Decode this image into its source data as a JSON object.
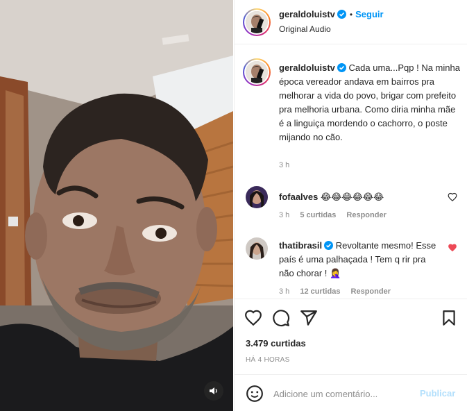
{
  "post": {
    "username": "geraldoluistv",
    "follow_label": "Seguir",
    "separator": "•",
    "audio": "Original Audio",
    "caption": "Cada uma...Pqp ! Na minha época vereador andava em bairros pra melhorar a vida do povo, brigar com prefeito pra melhoria urbana. Como diria minha mãe é a linguiça mordendo o cachorro, o poste mijando no cão.",
    "caption_time": "3 h",
    "likes": "3.479 curtidas",
    "posted_ago": "HÁ 4 HORAS"
  },
  "comments": [
    {
      "username": "fofaalves",
      "verified": false,
      "text": "😂😂😂😂😂😂",
      "time": "3 h",
      "likes": "5 curtidas",
      "reply": "Responder",
      "liked": false
    },
    {
      "username": "thatibrasil",
      "verified": true,
      "text": "Revoltante mesmo! Esse país é uma palhaçada ! Tem q rir pra não chorar ! 🤦‍♀️",
      "time": "3 h",
      "likes": "12 curtidas",
      "reply": "Responder",
      "liked": true
    }
  ],
  "composer": {
    "placeholder": "Adicione um comentário...",
    "publish_label": "Publicar"
  },
  "icons": {
    "verified": "verified-badge-icon",
    "like": "heart-icon",
    "comment": "speech-bubble-icon",
    "share": "paper-plane-icon",
    "save": "bookmark-icon",
    "emoji": "smiley-icon",
    "mute": "speaker-icon"
  },
  "colors": {
    "accent": "#0095f6",
    "publish_disabled": "#b2dffc",
    "liked": "#ed4956",
    "muted_text": "#8e8e8e"
  }
}
